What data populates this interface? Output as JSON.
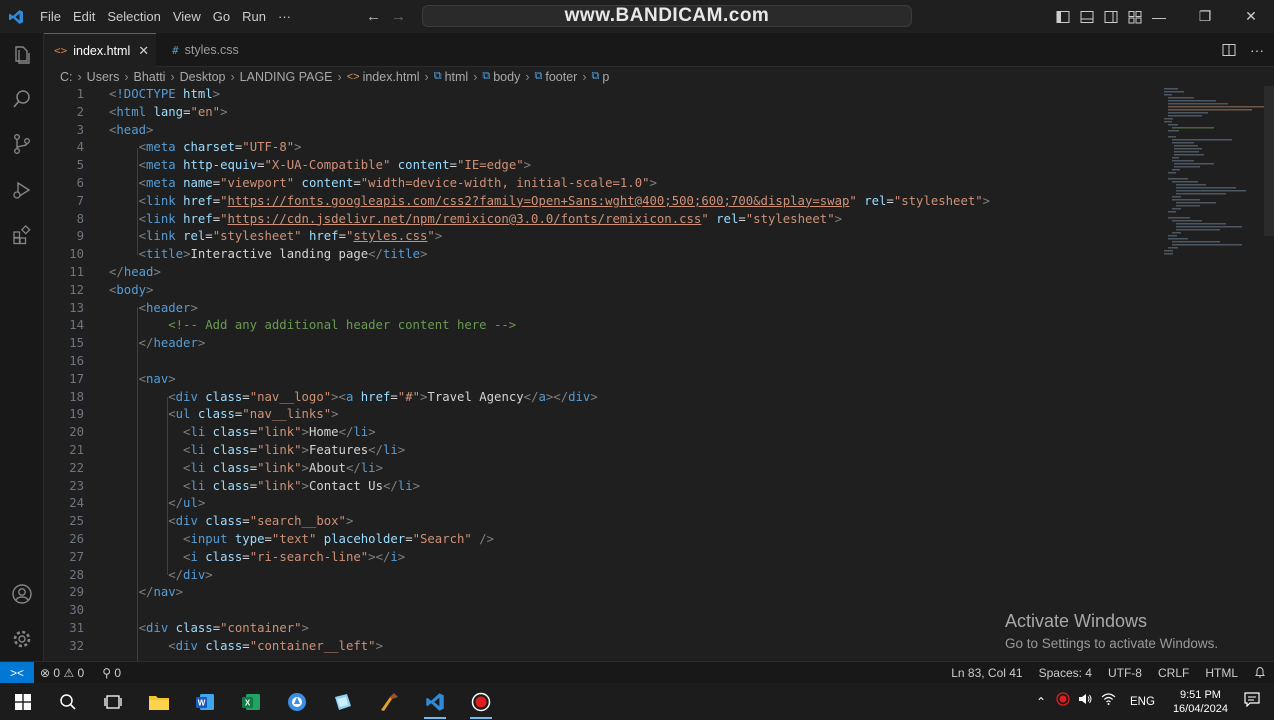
{
  "titlebar": {
    "menu": [
      "File",
      "Edit",
      "Selection",
      "View",
      "Go",
      "Run",
      "···"
    ],
    "watermark": "www.BANDICAM.com",
    "back_arrow": "←",
    "forward_arrow": "→",
    "minimize": "—",
    "restore": "❐",
    "close": "✕"
  },
  "tabs": [
    {
      "icon": "<>",
      "label": "index.html",
      "close": "✕"
    },
    {
      "icon": "#",
      "label": "styles.css"
    }
  ],
  "breadcrumb": [
    "C:",
    "Users",
    "Bhatti",
    "Desktop",
    "LANDING PAGE",
    "index.html",
    "html",
    "body",
    "footer",
    "p"
  ],
  "code_lines": [
    {
      "n": "1",
      "parts": [
        [
          "t-br",
          "<"
        ],
        [
          "t-tag",
          "!DOCTYPE"
        ],
        [
          "t-text",
          " "
        ],
        [
          "t-attr",
          "html"
        ],
        [
          "t-br",
          ">"
        ]
      ]
    },
    {
      "n": "2",
      "parts": [
        [
          "t-br",
          "<"
        ],
        [
          "t-tag",
          "html"
        ],
        [
          "t-text",
          " "
        ],
        [
          "t-attr",
          "lang"
        ],
        [
          "t-text",
          "="
        ],
        [
          "t-str",
          "\"en\""
        ],
        [
          "t-br",
          ">"
        ]
      ]
    },
    {
      "n": "3",
      "parts": [
        [
          "t-br",
          "<"
        ],
        [
          "t-tag",
          "head"
        ],
        [
          "t-br",
          ">"
        ]
      ]
    },
    {
      "n": "4",
      "parts": [
        [
          "t-text",
          "    "
        ],
        [
          "t-br",
          "<"
        ],
        [
          "t-tag",
          "meta"
        ],
        [
          "t-text",
          " "
        ],
        [
          "t-attr",
          "charset"
        ],
        [
          "t-text",
          "="
        ],
        [
          "t-str",
          "\"UTF-8\""
        ],
        [
          "t-br",
          ">"
        ]
      ]
    },
    {
      "n": "5",
      "parts": [
        [
          "t-text",
          "    "
        ],
        [
          "t-br",
          "<"
        ],
        [
          "t-tag",
          "meta"
        ],
        [
          "t-text",
          " "
        ],
        [
          "t-attr",
          "http-equiv"
        ],
        [
          "t-text",
          "="
        ],
        [
          "t-str",
          "\"X-UA-Compatible\""
        ],
        [
          "t-text",
          " "
        ],
        [
          "t-attr",
          "content"
        ],
        [
          "t-text",
          "="
        ],
        [
          "t-str",
          "\"IE=edge\""
        ],
        [
          "t-br",
          ">"
        ]
      ]
    },
    {
      "n": "6",
      "parts": [
        [
          "t-text",
          "    "
        ],
        [
          "t-br",
          "<"
        ],
        [
          "t-tag",
          "meta"
        ],
        [
          "t-text",
          " "
        ],
        [
          "t-attr",
          "name"
        ],
        [
          "t-text",
          "="
        ],
        [
          "t-str",
          "\"viewport\""
        ],
        [
          "t-text",
          " "
        ],
        [
          "t-attr",
          "content"
        ],
        [
          "t-text",
          "="
        ],
        [
          "t-str",
          "\"width=device-width, initial-scale=1.0\""
        ],
        [
          "t-br",
          ">"
        ]
      ]
    },
    {
      "n": "7",
      "parts": [
        [
          "t-text",
          "    "
        ],
        [
          "t-br",
          "<"
        ],
        [
          "t-tag",
          "link"
        ],
        [
          "t-text",
          " "
        ],
        [
          "t-attr",
          "href"
        ],
        [
          "t-text",
          "="
        ],
        [
          "t-str",
          "\""
        ],
        [
          "t-link",
          "https://fonts.googleapis.com/css2?family=Open+Sans:wght@400;500;600;700&display=swap"
        ],
        [
          "t-str",
          "\""
        ],
        [
          "t-text",
          " "
        ],
        [
          "t-attr",
          "rel"
        ],
        [
          "t-text",
          "="
        ],
        [
          "t-str",
          "\"stylesheet\""
        ],
        [
          "t-br",
          ">"
        ]
      ]
    },
    {
      "n": "8",
      "parts": [
        [
          "t-text",
          "    "
        ],
        [
          "t-br",
          "<"
        ],
        [
          "t-tag",
          "link"
        ],
        [
          "t-text",
          " "
        ],
        [
          "t-attr",
          "href"
        ],
        [
          "t-text",
          "="
        ],
        [
          "t-str",
          "\""
        ],
        [
          "t-link",
          "https://cdn.jsdelivr.net/npm/remixicon@3.0.0/fonts/remixicon.css"
        ],
        [
          "t-str",
          "\""
        ],
        [
          "t-text",
          " "
        ],
        [
          "t-attr",
          "rel"
        ],
        [
          "t-text",
          "="
        ],
        [
          "t-str",
          "\"stylesheet\""
        ],
        [
          "t-br",
          ">"
        ]
      ]
    },
    {
      "n": "9",
      "parts": [
        [
          "t-text",
          "    "
        ],
        [
          "t-br",
          "<"
        ],
        [
          "t-tag",
          "link"
        ],
        [
          "t-text",
          " "
        ],
        [
          "t-attr",
          "rel"
        ],
        [
          "t-text",
          "="
        ],
        [
          "t-str",
          "\"stylesheet\""
        ],
        [
          "t-text",
          " "
        ],
        [
          "t-attr",
          "href"
        ],
        [
          "t-text",
          "="
        ],
        [
          "t-str",
          "\""
        ],
        [
          "t-link",
          "styles.css"
        ],
        [
          "t-str",
          "\""
        ],
        [
          "t-br",
          ">"
        ]
      ]
    },
    {
      "n": "10",
      "parts": [
        [
          "t-text",
          "    "
        ],
        [
          "t-br",
          "<"
        ],
        [
          "t-tag",
          "title"
        ],
        [
          "t-br",
          ">"
        ],
        [
          "t-text",
          "Interactive landing page"
        ],
        [
          "t-br",
          "</"
        ],
        [
          "t-tag",
          "title"
        ],
        [
          "t-br",
          ">"
        ]
      ]
    },
    {
      "n": "11",
      "parts": [
        [
          "t-br",
          "</"
        ],
        [
          "t-tag",
          "head"
        ],
        [
          "t-br",
          ">"
        ]
      ]
    },
    {
      "n": "12",
      "parts": [
        [
          "t-br",
          "<"
        ],
        [
          "t-tag",
          "body"
        ],
        [
          "t-br",
          ">"
        ]
      ]
    },
    {
      "n": "13",
      "parts": [
        [
          "t-text",
          "    "
        ],
        [
          "t-br",
          "<"
        ],
        [
          "t-tag",
          "header"
        ],
        [
          "t-br",
          ">"
        ]
      ]
    },
    {
      "n": "14",
      "parts": [
        [
          "t-text",
          "        "
        ],
        [
          "t-cmt",
          "<!-- Add any additional header content here -->"
        ]
      ]
    },
    {
      "n": "15",
      "parts": [
        [
          "t-text",
          "    "
        ],
        [
          "t-br",
          "</"
        ],
        [
          "t-tag",
          "header"
        ],
        [
          "t-br",
          ">"
        ]
      ]
    },
    {
      "n": "16",
      "parts": []
    },
    {
      "n": "17",
      "parts": [
        [
          "t-text",
          "    "
        ],
        [
          "t-br",
          "<"
        ],
        [
          "t-tag",
          "nav"
        ],
        [
          "t-br",
          ">"
        ]
      ]
    },
    {
      "n": "18",
      "parts": [
        [
          "t-text",
          "        "
        ],
        [
          "t-br",
          "<"
        ],
        [
          "t-tag",
          "div"
        ],
        [
          "t-text",
          " "
        ],
        [
          "t-attr",
          "class"
        ],
        [
          "t-text",
          "="
        ],
        [
          "t-str",
          "\"nav__logo\""
        ],
        [
          "t-br",
          "><"
        ],
        [
          "t-tag",
          "a"
        ],
        [
          "t-text",
          " "
        ],
        [
          "t-attr",
          "href"
        ],
        [
          "t-text",
          "="
        ],
        [
          "t-str",
          "\"#\""
        ],
        [
          "t-br",
          ">"
        ],
        [
          "t-text",
          "Travel Agency"
        ],
        [
          "t-br",
          "</"
        ],
        [
          "t-tag",
          "a"
        ],
        [
          "t-br",
          "></"
        ],
        [
          "t-tag",
          "div"
        ],
        [
          "t-br",
          ">"
        ]
      ]
    },
    {
      "n": "19",
      "parts": [
        [
          "t-text",
          "        "
        ],
        [
          "t-br",
          "<"
        ],
        [
          "t-tag",
          "ul"
        ],
        [
          "t-text",
          " "
        ],
        [
          "t-attr",
          "class"
        ],
        [
          "t-text",
          "="
        ],
        [
          "t-str",
          "\"nav__links\""
        ],
        [
          "t-br",
          ">"
        ]
      ]
    },
    {
      "n": "20",
      "parts": [
        [
          "t-text",
          "          "
        ],
        [
          "t-br",
          "<"
        ],
        [
          "t-tag",
          "li"
        ],
        [
          "t-text",
          " "
        ],
        [
          "t-attr",
          "class"
        ],
        [
          "t-text",
          "="
        ],
        [
          "t-str",
          "\"link\""
        ],
        [
          "t-br",
          ">"
        ],
        [
          "t-text",
          "Home"
        ],
        [
          "t-br",
          "</"
        ],
        [
          "t-tag",
          "li"
        ],
        [
          "t-br",
          ">"
        ]
      ]
    },
    {
      "n": "21",
      "parts": [
        [
          "t-text",
          "          "
        ],
        [
          "t-br",
          "<"
        ],
        [
          "t-tag",
          "li"
        ],
        [
          "t-text",
          " "
        ],
        [
          "t-attr",
          "class"
        ],
        [
          "t-text",
          "="
        ],
        [
          "t-str",
          "\"link\""
        ],
        [
          "t-br",
          ">"
        ],
        [
          "t-text",
          "Features"
        ],
        [
          "t-br",
          "</"
        ],
        [
          "t-tag",
          "li"
        ],
        [
          "t-br",
          ">"
        ]
      ]
    },
    {
      "n": "22",
      "parts": [
        [
          "t-text",
          "          "
        ],
        [
          "t-br",
          "<"
        ],
        [
          "t-tag",
          "li"
        ],
        [
          "t-text",
          " "
        ],
        [
          "t-attr",
          "class"
        ],
        [
          "t-text",
          "="
        ],
        [
          "t-str",
          "\"link\""
        ],
        [
          "t-br",
          ">"
        ],
        [
          "t-text",
          "About"
        ],
        [
          "t-br",
          "</"
        ],
        [
          "t-tag",
          "li"
        ],
        [
          "t-br",
          ">"
        ]
      ]
    },
    {
      "n": "23",
      "parts": [
        [
          "t-text",
          "          "
        ],
        [
          "t-br",
          "<"
        ],
        [
          "t-tag",
          "li"
        ],
        [
          "t-text",
          " "
        ],
        [
          "t-attr",
          "class"
        ],
        [
          "t-text",
          "="
        ],
        [
          "t-str",
          "\"link\""
        ],
        [
          "t-br",
          ">"
        ],
        [
          "t-text",
          "Contact Us"
        ],
        [
          "t-br",
          "</"
        ],
        [
          "t-tag",
          "li"
        ],
        [
          "t-br",
          ">"
        ]
      ]
    },
    {
      "n": "24",
      "parts": [
        [
          "t-text",
          "        "
        ],
        [
          "t-br",
          "</"
        ],
        [
          "t-tag",
          "ul"
        ],
        [
          "t-br",
          ">"
        ]
      ]
    },
    {
      "n": "25",
      "parts": [
        [
          "t-text",
          "        "
        ],
        [
          "t-br",
          "<"
        ],
        [
          "t-tag",
          "div"
        ],
        [
          "t-text",
          " "
        ],
        [
          "t-attr",
          "class"
        ],
        [
          "t-text",
          "="
        ],
        [
          "t-str",
          "\"search__box\""
        ],
        [
          "t-br",
          ">"
        ]
      ]
    },
    {
      "n": "26",
      "parts": [
        [
          "t-text",
          "          "
        ],
        [
          "t-br",
          "<"
        ],
        [
          "t-tag",
          "input"
        ],
        [
          "t-text",
          " "
        ],
        [
          "t-attr",
          "type"
        ],
        [
          "t-text",
          "="
        ],
        [
          "t-str",
          "\"text\""
        ],
        [
          "t-text",
          " "
        ],
        [
          "t-attr",
          "placeholder"
        ],
        [
          "t-text",
          "="
        ],
        [
          "t-str",
          "\"Search\""
        ],
        [
          "t-text",
          " "
        ],
        [
          "t-br",
          "/>"
        ]
      ]
    },
    {
      "n": "27",
      "parts": [
        [
          "t-text",
          "          "
        ],
        [
          "t-br",
          "<"
        ],
        [
          "t-tag",
          "i"
        ],
        [
          "t-text",
          " "
        ],
        [
          "t-attr",
          "class"
        ],
        [
          "t-text",
          "="
        ],
        [
          "t-str",
          "\"ri-search-line\""
        ],
        [
          "t-br",
          "></"
        ],
        [
          "t-tag",
          "i"
        ],
        [
          "t-br",
          ">"
        ]
      ]
    },
    {
      "n": "28",
      "parts": [
        [
          "t-text",
          "        "
        ],
        [
          "t-br",
          "</"
        ],
        [
          "t-tag",
          "div"
        ],
        [
          "t-br",
          ">"
        ]
      ]
    },
    {
      "n": "29",
      "parts": [
        [
          "t-text",
          "    "
        ],
        [
          "t-br",
          "</"
        ],
        [
          "t-tag",
          "nav"
        ],
        [
          "t-br",
          ">"
        ]
      ]
    },
    {
      "n": "30",
      "parts": []
    },
    {
      "n": "31",
      "parts": [
        [
          "t-text",
          "    "
        ],
        [
          "t-br",
          "<"
        ],
        [
          "t-tag",
          "div"
        ],
        [
          "t-text",
          " "
        ],
        [
          "t-attr",
          "class"
        ],
        [
          "t-text",
          "="
        ],
        [
          "t-str",
          "\"container\""
        ],
        [
          "t-br",
          ">"
        ]
      ]
    },
    {
      "n": "32",
      "parts": [
        [
          "t-text",
          "        "
        ],
        [
          "t-br",
          "<"
        ],
        [
          "t-tag",
          "div"
        ],
        [
          "t-text",
          " "
        ],
        [
          "t-attr",
          "class"
        ],
        [
          "t-text",
          "="
        ],
        [
          "t-str",
          "\"container__left\""
        ],
        [
          "t-br",
          ">"
        ]
      ]
    }
  ],
  "activate_windows": {
    "title": "Activate Windows",
    "subtitle": "Go to Settings to activate Windows."
  },
  "statusbar": {
    "errors": "0",
    "warnings": "0",
    "ports": "0",
    "cursor": "Ln 83, Col 41",
    "spaces": "Spaces: 4",
    "encoding": "UTF-8",
    "eol": "CRLF",
    "language": "HTML"
  },
  "taskbar": {
    "language": "ENG",
    "time": "9:51 PM",
    "date": "16/04/2024"
  },
  "colors": {
    "accent": "#0078d4",
    "tag": "#569cd6",
    "attribute": "#9cdcfe",
    "string": "#ce9178",
    "comment": "#6a9955"
  }
}
